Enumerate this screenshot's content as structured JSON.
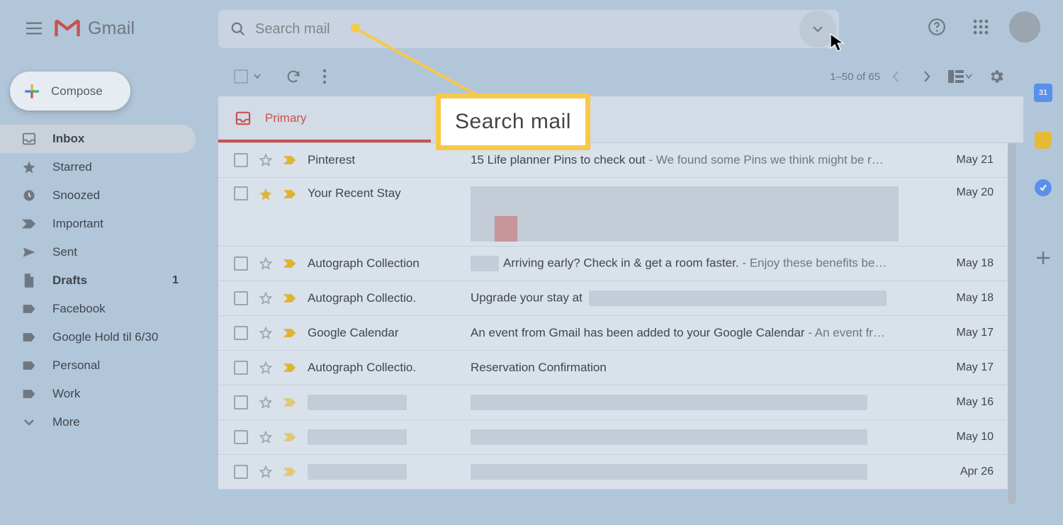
{
  "header": {
    "product": "Gmail",
    "search_placeholder": "Search mail"
  },
  "callout_text": "Search mail",
  "compose_label": "Compose",
  "sidebar": [
    {
      "label": "Inbox",
      "bold": true,
      "active": true,
      "icon": "inbox"
    },
    {
      "label": "Starred",
      "icon": "star"
    },
    {
      "label": "Snoozed",
      "icon": "clock"
    },
    {
      "label": "Important",
      "icon": "importance"
    },
    {
      "label": "Sent",
      "icon": "send"
    },
    {
      "label": "Drafts",
      "bold": true,
      "count": "1",
      "icon": "file"
    },
    {
      "label": "Facebook",
      "icon": "label"
    },
    {
      "label": "Google Hold til 6/30",
      "icon": "label"
    },
    {
      "label": "Personal",
      "icon": "label"
    },
    {
      "label": "Work",
      "icon": "label"
    },
    {
      "label": "More",
      "icon": "expand"
    }
  ],
  "toolbar": {
    "page_text": "1–50 of 65"
  },
  "tabs": {
    "primary": "Primary"
  },
  "sidepanel": {
    "calendar_day": "31"
  },
  "emails": [
    {
      "sender": "Pinterest",
      "subject": "15 Life planner Pins to check out",
      "snippet": " - We found some Pins we think might be r…",
      "date": "May 21",
      "important": true
    },
    {
      "sender": "Your Recent Stay",
      "subject_redacted": true,
      "date": "May 20",
      "starred": true,
      "important": true,
      "tall": true
    },
    {
      "sender": "Autograph Collection",
      "subject_prefix_redacted": true,
      "subject": "Arriving early? Check in & get a room faster.",
      "snippet": " - Enjoy these benefits be…",
      "date": "May 18",
      "important": true
    },
    {
      "sender": "Autograph Collectio.",
      "subject": "Upgrade your stay at ",
      "subject_suffix_redacted": true,
      "date": "May 18",
      "important": true
    },
    {
      "sender": "Google Calendar",
      "subject": "An event from Gmail has been added to your Google Calendar",
      "snippet": " - An event fr…",
      "date": "May 17",
      "important": true
    },
    {
      "sender": "Autograph Collectio.",
      "subject": "Reservation Confirmation",
      "date": "May 17",
      "important": true
    },
    {
      "sender_redacted": true,
      "subject_redacted": true,
      "date": "May 16",
      "important": true,
      "imp_light": true
    },
    {
      "sender_redacted": true,
      "subject_redacted": true,
      "date": "May 10",
      "important": true,
      "imp_light": true
    },
    {
      "sender_redacted": true,
      "subject_redacted": true,
      "date": "Apr 26",
      "important": true,
      "imp_light": true
    }
  ]
}
